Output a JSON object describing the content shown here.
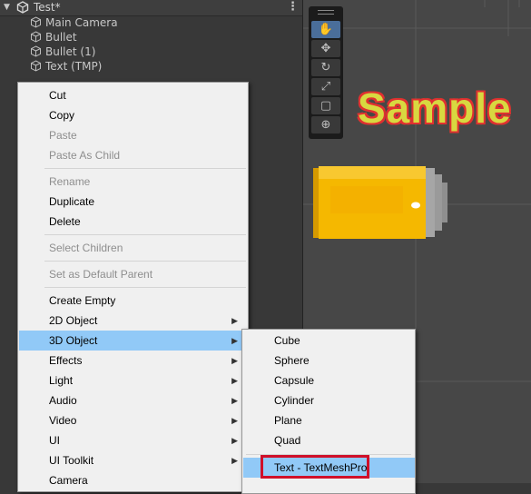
{
  "hierarchy": {
    "scene_name": "Test*",
    "items": [
      "Main Camera",
      "Bullet",
      "Bullet (1)",
      "Text (TMP)"
    ]
  },
  "scene_view": {
    "sample_text": "Sample",
    "tools": [
      "hand-tool",
      "move-tool",
      "rotate-tool",
      "scale-tool",
      "rect-tool",
      "transform-tool"
    ],
    "active_tool": "hand-tool"
  },
  "context_menu": {
    "items": [
      {
        "label": "Cut",
        "enabled": true
      },
      {
        "label": "Copy",
        "enabled": true
      },
      {
        "label": "Paste",
        "enabled": false
      },
      {
        "label": "Paste As Child",
        "enabled": false
      },
      {
        "label": "Rename",
        "enabled": false
      },
      {
        "label": "Duplicate",
        "enabled": true
      },
      {
        "label": "Delete",
        "enabled": true
      },
      {
        "label": "Select Children",
        "enabled": false
      },
      {
        "label": "Set as Default Parent",
        "enabled": false
      },
      {
        "label": "Create Empty",
        "enabled": true
      },
      {
        "label": "2D Object",
        "enabled": true,
        "submenu": true
      },
      {
        "label": "3D Object",
        "enabled": true,
        "submenu": true,
        "highlighted": true
      },
      {
        "label": "Effects",
        "enabled": true,
        "submenu": true
      },
      {
        "label": "Light",
        "enabled": true,
        "submenu": true
      },
      {
        "label": "Audio",
        "enabled": true,
        "submenu": true
      },
      {
        "label": "Video",
        "enabled": true,
        "submenu": true
      },
      {
        "label": "UI",
        "enabled": true,
        "submenu": true
      },
      {
        "label": "UI Toolkit",
        "enabled": true,
        "submenu": true
      },
      {
        "label": "Camera",
        "enabled": true
      }
    ]
  },
  "submenu_3d": {
    "items": [
      "Cube",
      "Sphere",
      "Capsule",
      "Cylinder",
      "Plane",
      "Quad",
      "Text - TextMeshPro"
    ],
    "highlighted": "Text - TextMeshPro"
  },
  "colors": {
    "menu_highlight": "#91c9f7",
    "annotation_box": "#d0102a",
    "bullet_body": "#f5b800",
    "bullet_tip": "#a6a6a6"
  }
}
